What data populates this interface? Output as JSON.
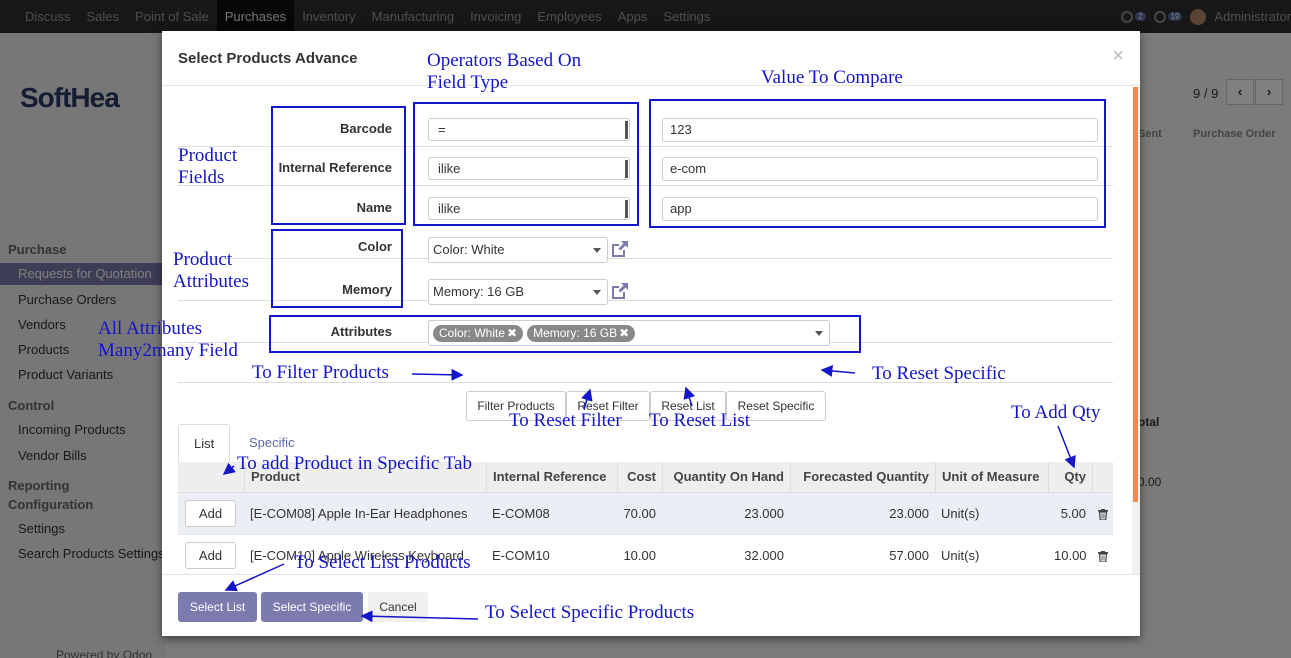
{
  "navbar": {
    "items": [
      "Discuss",
      "Sales",
      "Point of Sale",
      "Purchases",
      "Inventory",
      "Manufacturing",
      "Invoicing",
      "Employees",
      "Apps",
      "Settings"
    ],
    "active": "Purchases",
    "messages_count": "2",
    "activities_count": "19",
    "user": "Administrator"
  },
  "background": {
    "logo": "SoftHea",
    "sidebar": {
      "purchase_header": "Purchase",
      "purchase_items": [
        "Requests for Quotation",
        "Purchase Orders",
        "Vendors",
        "Products",
        "Product Variants"
      ],
      "control_header": "Control",
      "control_items": [
        "Incoming Products",
        "Vendor Bills"
      ],
      "reporting_header": "Reporting",
      "configuration_header": "Configuration",
      "configuration_items": [
        "Settings",
        "Search Products Settings"
      ],
      "powered": "Powered by Odoo"
    },
    "pager": "9 / 9",
    "breadcrumb": [
      "Sent",
      "Purchase Order"
    ],
    "total_label": "otal",
    "total_value": "0.00"
  },
  "modal": {
    "title": "Select Products Advance",
    "close": "×",
    "fields": {
      "barcode": {
        "label": "Barcode",
        "operator": "=",
        "value": "123"
      },
      "internal_reference": {
        "label": "Internal Reference",
        "operator": "ilike",
        "value": "e-com"
      },
      "name": {
        "label": "Name",
        "operator": "ilike",
        "value": "app"
      },
      "color": {
        "label": "Color",
        "value": "Color: White"
      },
      "memory": {
        "label": "Memory",
        "value": "Memory: 16 GB"
      },
      "attributes": {
        "label": "Attributes",
        "tags": [
          "Color: White",
          "Memory: 16 GB"
        ]
      }
    },
    "actions": {
      "filter_products": "Filter Products",
      "reset_filter": "Reset Filter",
      "reset_list": "Reset List",
      "reset_specific": "Reset Specific"
    },
    "tabs": [
      "List",
      "Specific"
    ],
    "table": {
      "columns": [
        "Product",
        "Internal Reference",
        "Cost",
        "Quantity On Hand",
        "Forecasted Quantity",
        "Unit of Measure",
        "Qty"
      ],
      "rows": [
        {
          "add": "Add",
          "product": "[E-COM08] Apple In-Ear Headphones",
          "ref": "E-COM08",
          "cost": "70.00",
          "on_hand": "23.000",
          "forecast": "23.000",
          "uom": "Unit(s)",
          "qty": "5.00"
        },
        {
          "add": "Add",
          "product": "[E-COM10] Apple Wireless Keyboard",
          "ref": "E-COM10",
          "cost": "10.00",
          "on_hand": "32.000",
          "forecast": "57.000",
          "uom": "Unit(s)",
          "qty": "10.00"
        }
      ]
    },
    "footer": {
      "select_list": "Select List",
      "select_specific": "Select Specific",
      "cancel": "Cancel"
    }
  },
  "annotations": {
    "operators": [
      "Operators Based On",
      "Field Type"
    ],
    "value_to_compare": "Value To Compare",
    "product_fields": [
      "Product",
      "Fields"
    ],
    "product_attributes": [
      "Product",
      "Attributes"
    ],
    "all_attributes": [
      "All Attributes",
      "Many2many Field"
    ],
    "to_filter_products": "To Filter Products",
    "to_reset_specific": "To Reset Specific",
    "to_reset_filter": "To Reset Filter",
    "to_reset_list": "To Reset List",
    "to_add_qty": "To Add Qty",
    "to_add_product_specific": "To add Product in Specific Tab",
    "to_select_list_products": "To Select List Products",
    "to_select_specific_products": "To Select Specific Products",
    "color": "#1414c8"
  }
}
